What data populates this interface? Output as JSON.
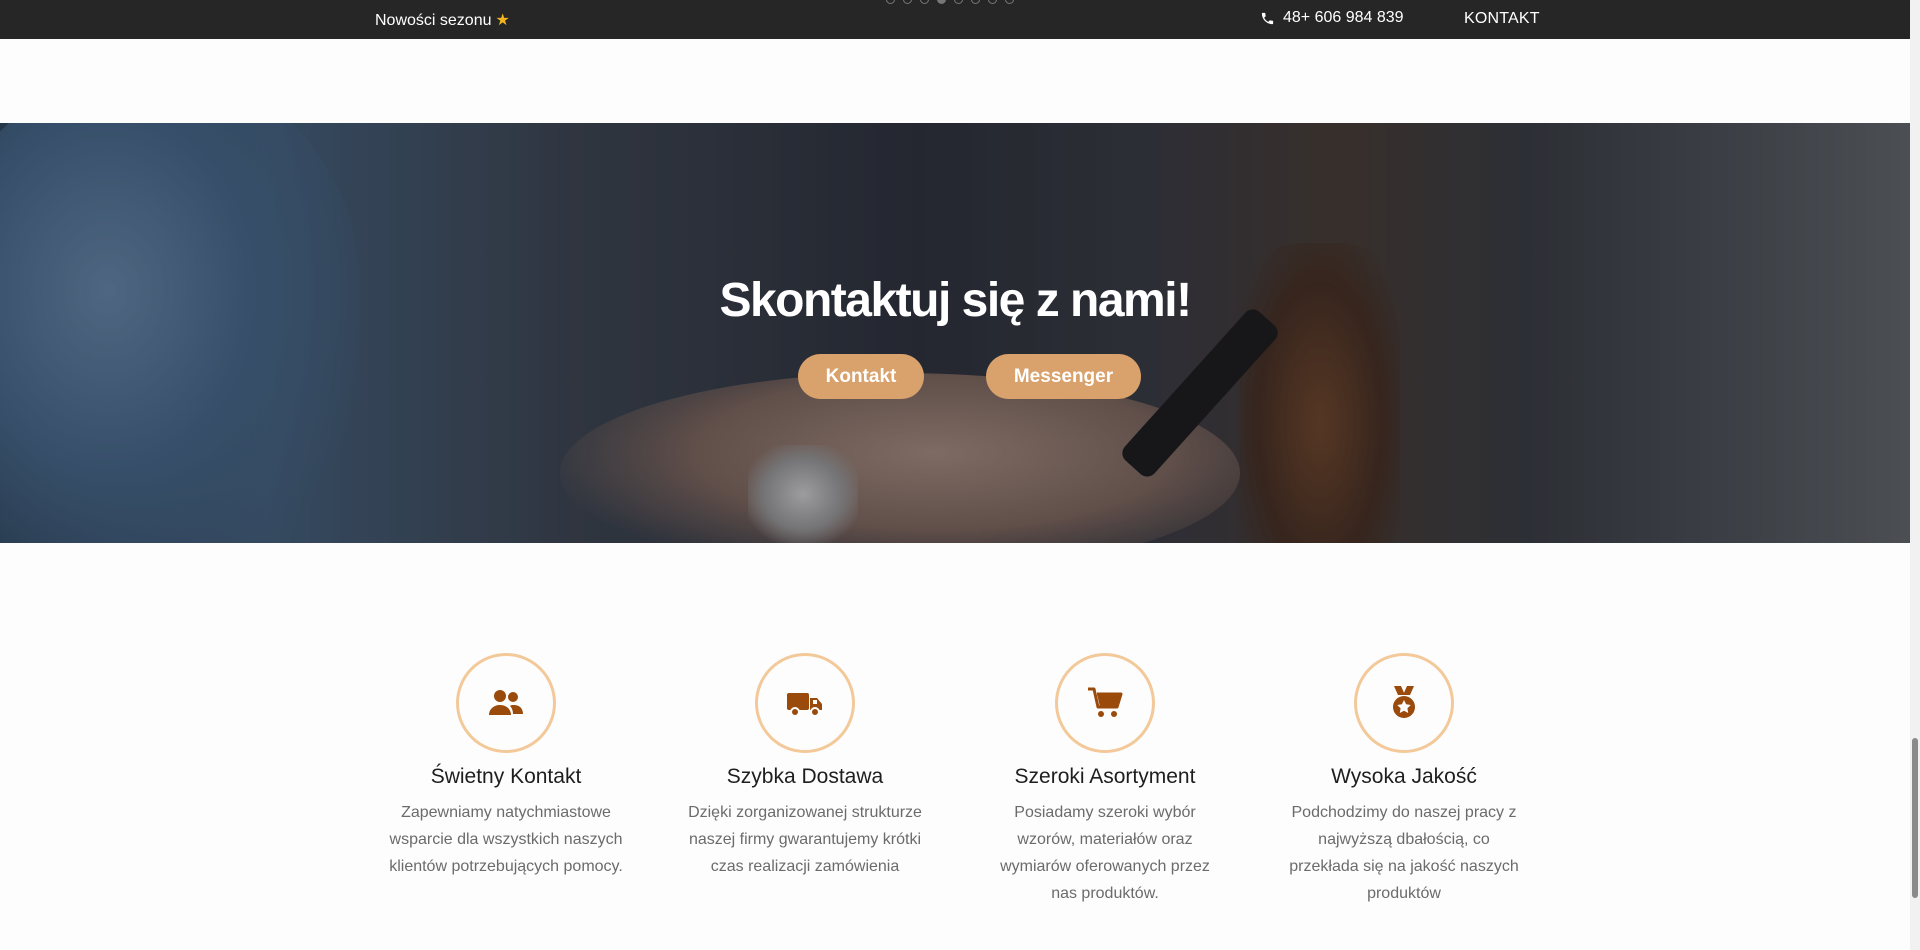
{
  "topbar": {
    "promo_label": "Nowości sezonu",
    "promo_star": "★",
    "phone_icon": "phone-icon",
    "phone": "48+ 606 984 839",
    "contact_link": "KONTAKT",
    "slider_dots": {
      "count": 8,
      "active_index": 3
    }
  },
  "hero": {
    "title": "Skontaktuj się z nami!",
    "buttons": {
      "kontakt": "Kontakt",
      "messenger": "Messenger"
    }
  },
  "features": [
    {
      "icon": "users-icon",
      "title": "Świetny Kontakt",
      "text": "Zapewniamy natychmiastowe wsparcie dla wszystkich naszych klientów potrzebujących pomocy."
    },
    {
      "icon": "truck-icon",
      "title": "Szybka Dostawa",
      "text": "Dzięki zorganizowanej strukturze naszej firmy gwarantujemy krótki czas realizacji zamówienia"
    },
    {
      "icon": "cart-icon",
      "title": "Szeroki Asortyment",
      "text": "Posiadamy szeroki wybór wzorów, materiałów oraz wymiarów oferowanych przez nas produktów."
    },
    {
      "icon": "medal-icon",
      "title": "Wysoka Jakość",
      "text": "Podchodzimy do naszej pracy z najwyższą dbałością, co przekłada się na jakość naszych produktów"
    }
  ],
  "colors": {
    "topbar_bg": "#262626",
    "accent_button": "#d9a16b",
    "icon_ring": "#f3c99a",
    "icon_fill": "#9a4a0a",
    "star": "#f3b51d"
  }
}
